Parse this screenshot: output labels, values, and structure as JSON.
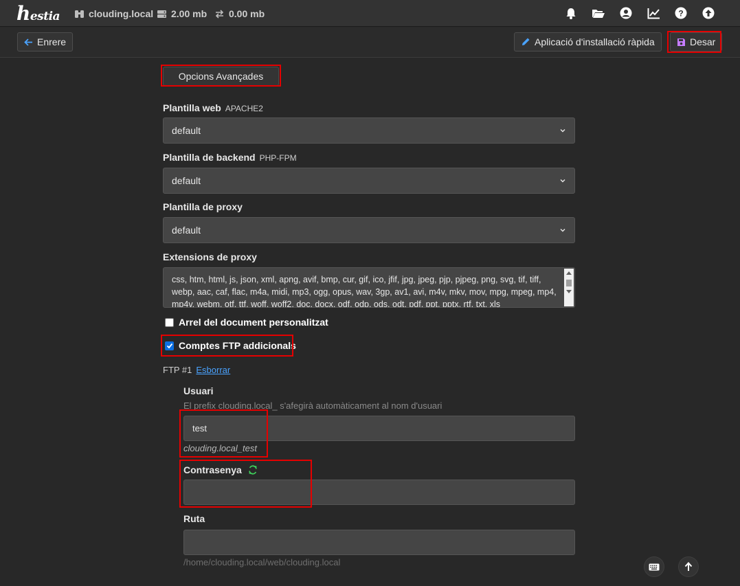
{
  "app": {
    "logo_text_first": "h",
    "logo_text_rest": "estia"
  },
  "header": {
    "domain": "clouding.local",
    "disk_usage": "2.00 mb",
    "bandwidth": "0.00 mb",
    "icons": [
      "bell-icon",
      "folder-icon",
      "user-icon",
      "chart-icon",
      "help-icon",
      "upload-icon"
    ]
  },
  "toolbar": {
    "back_label": "Enrere",
    "quick_install_label": "Aplicació d'installació ràpida",
    "save_label": "Desar"
  },
  "form": {
    "advanced_options_label": "Opcions Avançades",
    "web_template": {
      "label": "Plantilla web",
      "hint": "APACHE2",
      "value": "default"
    },
    "backend_template": {
      "label": "Plantilla de backend",
      "hint": "PHP-FPM",
      "value": "default"
    },
    "proxy_template": {
      "label": "Plantilla de proxy",
      "value": "default"
    },
    "proxy_extensions": {
      "label": "Extensions de proxy",
      "value": "css, htm, html, js, json, xml, apng, avif, bmp, cur, gif, ico, jfif, jpg, jpeg, pjp, pjpeg, png, svg, tif, tiff, webp, aac, caf, flac, m4a, midi, mp3, ogg, opus, wav, 3gp, av1, avi, m4v, mkv, mov, mpg, mpeg, mp4, mp4v, webm, otf, ttf, woff, woff2, doc, docx, odf, odp, ods, odt, pdf, ppt, pptx, rtf, txt, xls"
    },
    "custom_docroot": {
      "label": "Arrel del document personalitzat",
      "checked": false
    },
    "additional_ftp": {
      "label": "Comptes FTP addicionals",
      "checked": true
    },
    "ftp": {
      "title": "FTP #1",
      "delete_label": "Esborrar",
      "user_label": "Usuari",
      "user_hint": "El prefix clouding.local_ s'afegirà automàticament al nom d'usuari",
      "user_value": "test",
      "user_full": "clouding.local_test",
      "password_label": "Contrasenya",
      "password_value": "",
      "path_label": "Ruta",
      "path_value": "",
      "path_hint": "/home/clouding.local/web/clouding.local"
    }
  },
  "colors": {
    "highlight": "#e60000",
    "accent_link": "#4aa3ff",
    "save_icon": "#c77dff",
    "refresh_icon": "#3ecf5a"
  }
}
